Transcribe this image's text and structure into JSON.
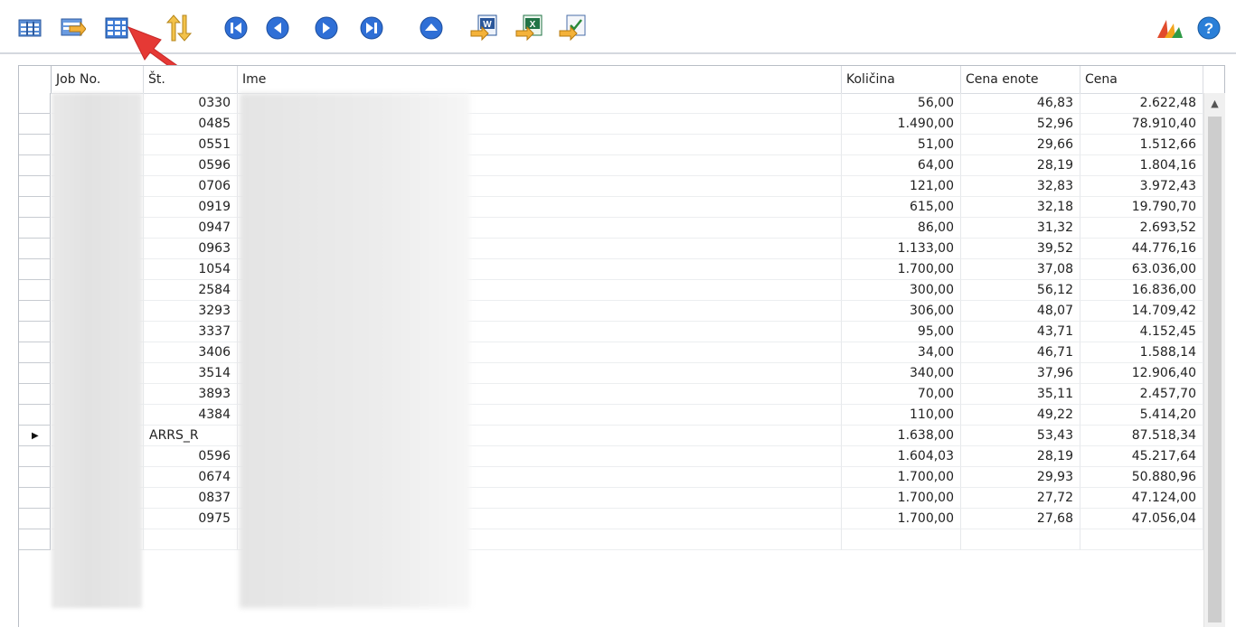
{
  "toolbar": {
    "icons": [
      "list-view-icon",
      "card-view-icon",
      "table-grid-icon",
      "sort-arrows-icon",
      "first-record-icon",
      "previous-record-icon",
      "next-record-icon",
      "last-record-icon",
      "collapse-up-icon",
      "send-to-word-icon",
      "send-to-excel-icon",
      "send-to-task-icon",
      "dynamics-logo-icon",
      "help-icon"
    ],
    "colors": {
      "nav_blue": "#2f6fd6",
      "help_blue": "#2a7fd8",
      "arrow_red": "#e53935"
    }
  },
  "table": {
    "columns": [
      "Job No.",
      "Št.",
      "Ime",
      "Količina",
      "Cena enote",
      "Cena"
    ],
    "rows": [
      {
        "selected": false,
        "job": "",
        "st": "0330",
        "ime": "",
        "kolicina": "56,00",
        "cena_enote": "46,83",
        "cena": "2.622,48"
      },
      {
        "selected": false,
        "job": "",
        "st": "0485",
        "ime": "",
        "kolicina": "1.490,00",
        "cena_enote": "52,96",
        "cena": "78.910,40"
      },
      {
        "selected": false,
        "job": "",
        "st": "0551",
        "ime": "",
        "kolicina": "51,00",
        "cena_enote": "29,66",
        "cena": "1.512,66"
      },
      {
        "selected": false,
        "job": "",
        "st": "0596",
        "ime": "",
        "kolicina": "64,00",
        "cena_enote": "28,19",
        "cena": "1.804,16"
      },
      {
        "selected": false,
        "job": "",
        "st": "0706",
        "ime": "",
        "kolicina": "121,00",
        "cena_enote": "32,83",
        "cena": "3.972,43"
      },
      {
        "selected": false,
        "job": "",
        "st": "0919",
        "ime": "",
        "kolicina": "615,00",
        "cena_enote": "32,18",
        "cena": "19.790,70"
      },
      {
        "selected": false,
        "job": "",
        "st": "0947",
        "ime": "",
        "kolicina": "86,00",
        "cena_enote": "31,32",
        "cena": "2.693,52"
      },
      {
        "selected": false,
        "job": "",
        "st": "0963",
        "ime": "",
        "kolicina": "1.133,00",
        "cena_enote": "39,52",
        "cena": "44.776,16"
      },
      {
        "selected": false,
        "job": "",
        "st": "1054",
        "ime": "",
        "kolicina": "1.700,00",
        "cena_enote": "37,08",
        "cena": "63.036,00"
      },
      {
        "selected": false,
        "job": "",
        "st": "2584",
        "ime": "",
        "kolicina": "300,00",
        "cena_enote": "56,12",
        "cena": "16.836,00"
      },
      {
        "selected": false,
        "job": "",
        "st": "3293",
        "ime": "",
        "kolicina": "306,00",
        "cena_enote": "48,07",
        "cena": "14.709,42"
      },
      {
        "selected": false,
        "job": "",
        "st": "3337",
        "ime": "",
        "kolicina": "95,00",
        "cena_enote": "43,71",
        "cena": "4.152,45"
      },
      {
        "selected": false,
        "job": "",
        "st": "3406",
        "ime": "",
        "kolicina": "34,00",
        "cena_enote": "46,71",
        "cena": "1.588,14"
      },
      {
        "selected": false,
        "job": "",
        "st": "3514",
        "ime": "",
        "kolicina": "340,00",
        "cena_enote": "37,96",
        "cena": "12.906,40"
      },
      {
        "selected": false,
        "job": "",
        "st": "3893",
        "ime": "",
        "kolicina": "70,00",
        "cena_enote": "35,11",
        "cena": "2.457,70"
      },
      {
        "selected": false,
        "job": "",
        "st": "4384",
        "ime": "",
        "kolicina": "110,00",
        "cena_enote": "49,22",
        "cena": "5.414,20"
      },
      {
        "selected": true,
        "job": "",
        "st": "ARRS_R",
        "ime": "",
        "kolicina": "1.638,00",
        "cena_enote": "53,43",
        "cena": "87.518,34"
      },
      {
        "selected": false,
        "job": "",
        "st": "0596",
        "ime": "",
        "kolicina": "1.604,03",
        "cena_enote": "28,19",
        "cena": "45.217,64"
      },
      {
        "selected": false,
        "job": "",
        "st": "0674",
        "ime": "",
        "kolicina": "1.700,00",
        "cena_enote": "29,93",
        "cena": "50.880,96"
      },
      {
        "selected": false,
        "job": "",
        "st": "0837",
        "ime": "",
        "kolicina": "1.700,00",
        "cena_enote": "27,72",
        "cena": "47.124,00"
      },
      {
        "selected": false,
        "job": "",
        "st": "0975",
        "ime": "",
        "kolicina": "1.700,00",
        "cena_enote": "27,68",
        "cena": "47.056,04"
      },
      {
        "selected": false,
        "job": "",
        "st": "",
        "ime": "",
        "kolicina": "",
        "cena_enote": "",
        "cena": ""
      }
    ]
  }
}
